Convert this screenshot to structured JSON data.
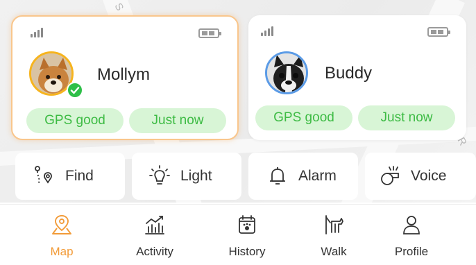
{
  "map": {
    "street_labels": [
      "S",
      "R"
    ]
  },
  "pets": [
    {
      "name": "Mollym",
      "gps_status": "GPS good",
      "last_update": "Just now",
      "selected": true,
      "avatar_ring_color": "#f6b41e"
    },
    {
      "name": "Buddy",
      "gps_status": "GPS good",
      "last_update": "Just now",
      "selected": false,
      "avatar_ring_color": "#5b9be6"
    }
  ],
  "actions": [
    {
      "label": "Find",
      "icon": "route-pin-icon"
    },
    {
      "label": "Light",
      "icon": "lightbulb-icon"
    },
    {
      "label": "Alarm",
      "icon": "bell-icon"
    },
    {
      "label": "Voice",
      "icon": "whistle-icon"
    }
  ],
  "tabs": [
    {
      "label": "Map",
      "icon": "map-pin-icon",
      "active": true
    },
    {
      "label": "Activity",
      "icon": "activity-chart-icon",
      "active": false
    },
    {
      "label": "History",
      "icon": "calendar-paw-icon",
      "active": false
    },
    {
      "label": "Walk",
      "icon": "dog-walk-icon",
      "active": false
    },
    {
      "label": "Profile",
      "icon": "person-icon",
      "active": false
    }
  ],
  "colors": {
    "accent": "#f29b38",
    "status_green": "#3dbb44",
    "status_bg": "#d8f5d6"
  }
}
